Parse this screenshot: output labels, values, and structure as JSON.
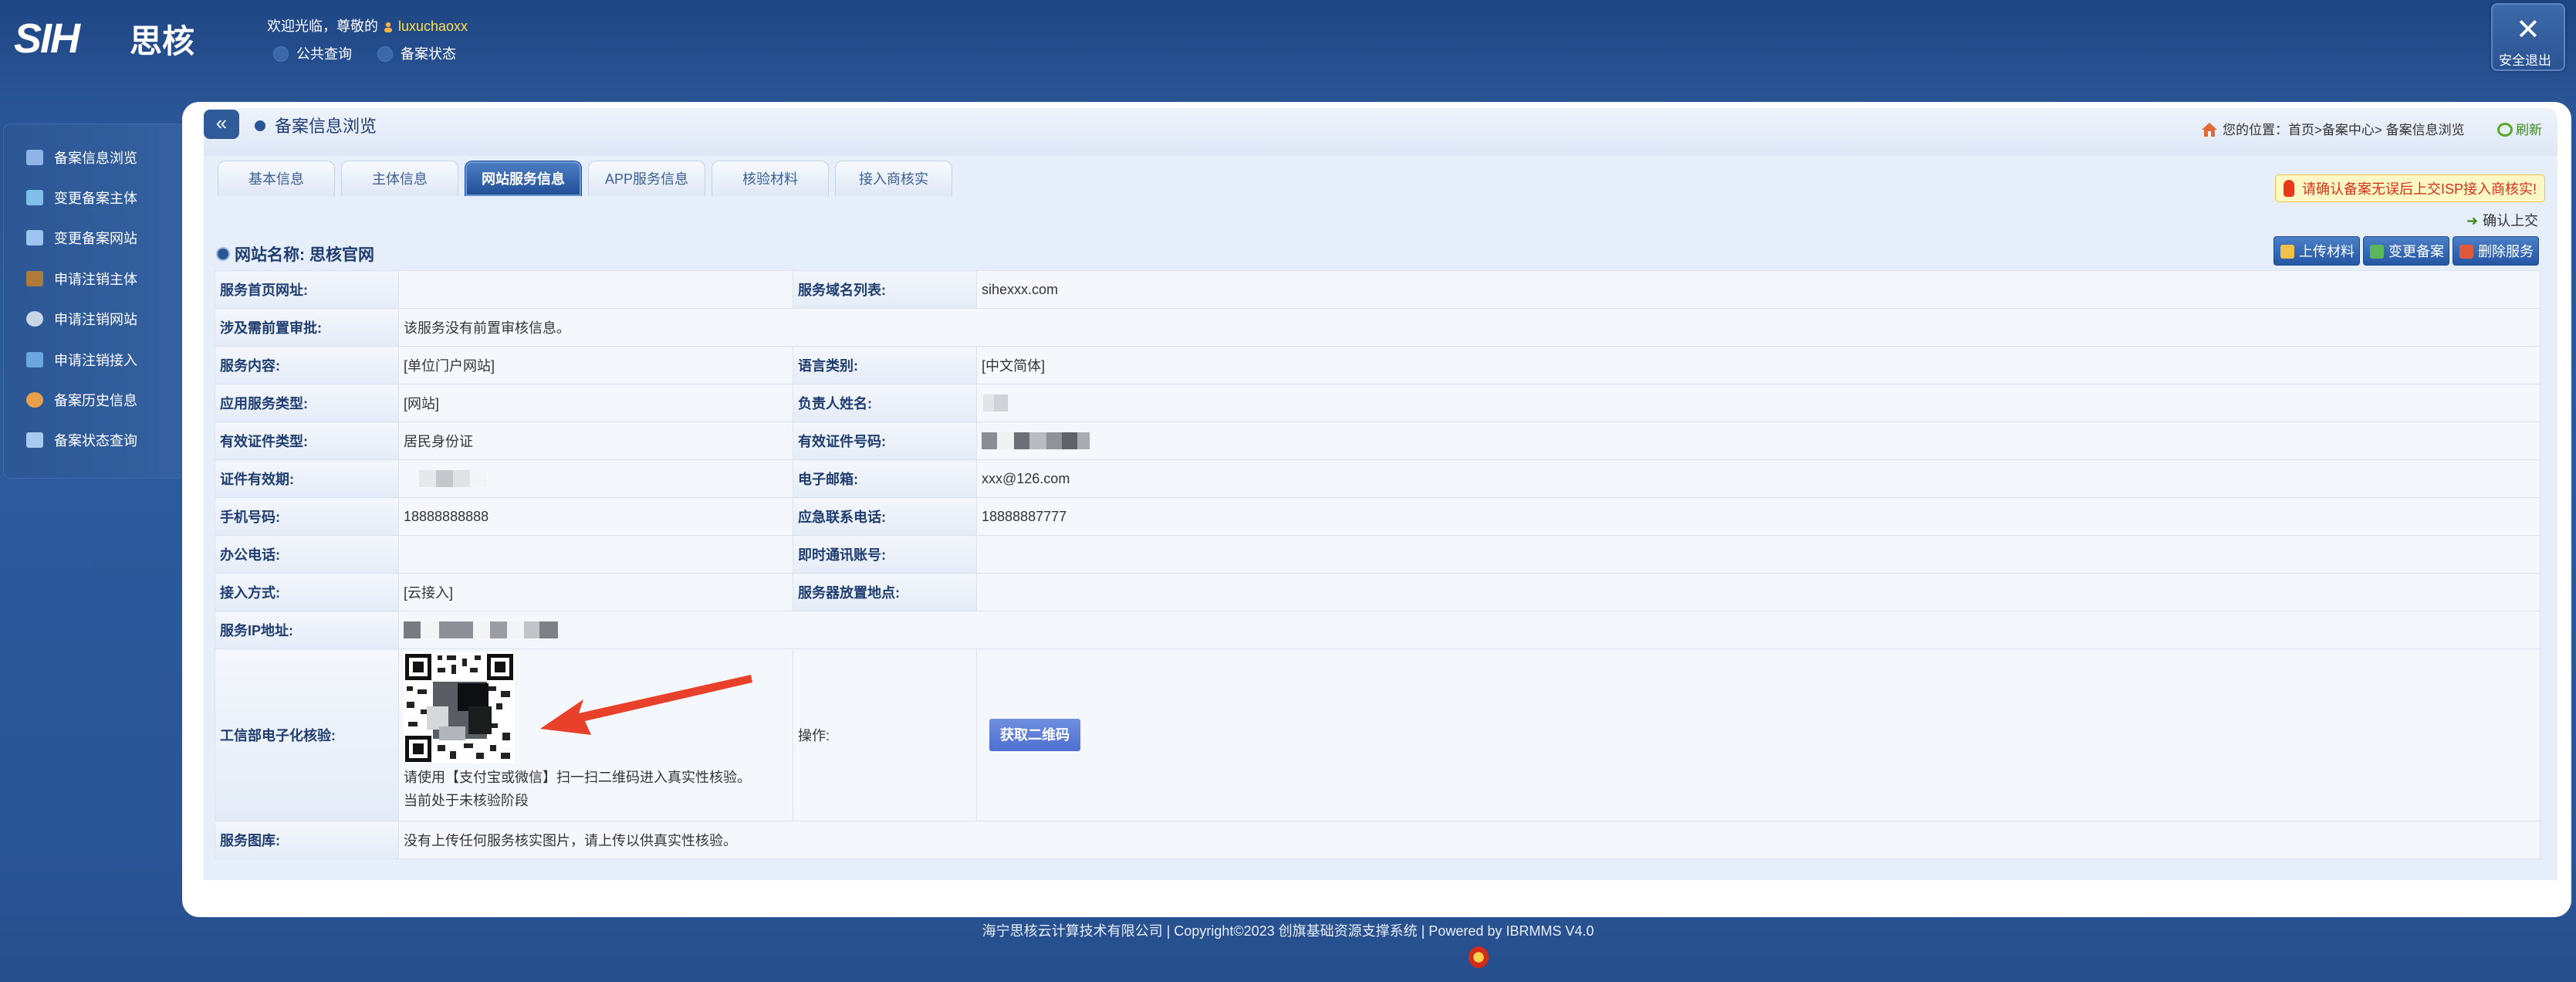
{
  "header": {
    "logo_text": "SIH 思核",
    "welcome_prefix": "欢迎光临，尊敬的",
    "username": "luxuchaoxx",
    "links": [
      "公共查询",
      "备案状态"
    ],
    "logout_label": "安全退出"
  },
  "sidebar": {
    "items": [
      {
        "label": "备案信息浏览",
        "icon": "browse-icon"
      },
      {
        "label": "变更备案主体",
        "icon": "change-entity-icon"
      },
      {
        "label": "变更备案网站",
        "icon": "change-site-icon"
      },
      {
        "label": "申请注销主体",
        "icon": "cancel-entity-icon"
      },
      {
        "label": "申请注销网站",
        "icon": "cancel-site-icon"
      },
      {
        "label": "申请注销接入",
        "icon": "cancel-access-icon"
      },
      {
        "label": "备案历史信息",
        "icon": "history-icon"
      },
      {
        "label": "备案状态查询",
        "icon": "status-query-icon"
      }
    ]
  },
  "page": {
    "collapse_label": "«",
    "title": "备案信息浏览",
    "breadcrumb": "您的位置：首页>备案中心> 备案信息浏览",
    "refresh_label": "刷新"
  },
  "tabs": [
    {
      "label": "基本信息",
      "active": false
    },
    {
      "label": "主体信息",
      "active": false
    },
    {
      "label": "网站服务信息",
      "active": true
    },
    {
      "label": "APP服务信息",
      "active": false
    },
    {
      "label": "核验材料",
      "active": false
    },
    {
      "label": "接入商核实",
      "active": false
    }
  ],
  "notice": {
    "warning": "请确认备案无误后上交ISP接入商核实!",
    "confirm_label": "确认上交"
  },
  "site": {
    "name_label": "网站名称:",
    "name": "思核官网",
    "actions": [
      "上传材料",
      "变更备案",
      "删除服务"
    ]
  },
  "table": {
    "rows": [
      {
        "l1": "服务首页网址:",
        "v1": "",
        "l2": "服务域名列表:",
        "v2": "sihexxx.com"
      },
      {
        "l1": "涉及需前置审批:",
        "v1": "该服务没有前置审核信息。",
        "span": true
      },
      {
        "l1": "服务内容:",
        "v1": "[单位门户网站]",
        "l2": "语言类别:",
        "v2": "[中文简体]"
      },
      {
        "l1": "应用服务类型:",
        "v1": "[网站]",
        "l2": "负责人姓名:",
        "v2": ""
      },
      {
        "l1": "有效证件类型:",
        "v1": "居民身份证",
        "l2": "有效证件号码:",
        "v2": ""
      },
      {
        "l1": "证件有效期:",
        "v1": "",
        "l2": "电子邮箱:",
        "v2": "xxx@126.com"
      },
      {
        "l1": "手机号码:",
        "v1": "18888888888",
        "l2": "应急联系电话:",
        "v2": "18888887777"
      },
      {
        "l1": "办公电话:",
        "v1": "",
        "l2": "即时通讯账号:",
        "v2": ""
      },
      {
        "l1": "接入方式:",
        "v1": "[云接入]",
        "l2": "服务器放置地点:",
        "v2": ""
      },
      {
        "l1": "服务IP地址:",
        "v1": "",
        "span": true
      }
    ],
    "verify": {
      "label": "工信部电子化核验:",
      "instruction": "请使用【支付宝或微信】扫一扫二维码进入真实性核验。",
      "status": "当前处于未核验阶段",
      "op_label": "操作:",
      "button": "获取二维码"
    },
    "gallery": {
      "label": "服务图库:",
      "text": "没有上传任何服务核实图片，请上传以供真实性核验。"
    }
  },
  "footer": {
    "text": "海宁思核云计算技术有限公司 | Copyright©2023 创旗基础资源支撑系统 | Powered by IBRMMS V4.0"
  },
  "colors": {
    "accent": "#2a5596",
    "warning_text": "#d3321a",
    "arrow": "#e8402a"
  }
}
